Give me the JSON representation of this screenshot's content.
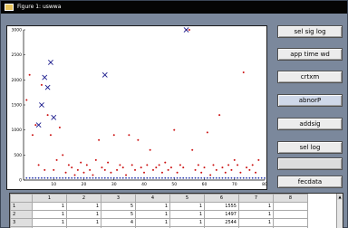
{
  "window": {
    "title": "Figure 1: uswwa"
  },
  "buttons": [
    {
      "label": "sel sig log",
      "state": "normal"
    },
    {
      "label": "app time wd",
      "state": "normal"
    },
    {
      "label": "crtxm",
      "state": "normal"
    },
    {
      "label": "abnorP",
      "state": "active"
    },
    {
      "label": "addsig",
      "state": "normal"
    },
    {
      "label": "sel log",
      "state": "normal"
    },
    {
      "label": "",
      "state": "blank"
    },
    {
      "label": "fecdata",
      "state": "normal"
    }
  ],
  "chart_data": {
    "type": "scatter",
    "xlim": [
      0,
      80
    ],
    "ylim": [
      0,
      3000
    ],
    "x_ticks": [
      "10",
      "20",
      "30",
      "40",
      "50",
      "60",
      "70",
      "80"
    ],
    "y_ticks": [
      "0",
      "500",
      "1000",
      "1500",
      "2000",
      "2500",
      "3000"
    ],
    "grid": false,
    "series": [
      {
        "marker": "red-dot",
        "color": "#cc1111",
        "points": [
          [
            1,
            1600
          ],
          [
            2,
            2100
          ],
          [
            3,
            900
          ],
          [
            4,
            1100
          ],
          [
            5,
            300
          ],
          [
            6,
            1900
          ],
          [
            7,
            200
          ],
          [
            8,
            1300
          ],
          [
            9,
            900
          ],
          [
            10,
            200
          ],
          [
            11,
            400
          ],
          [
            12,
            1050
          ],
          [
            13,
            500
          ],
          [
            14,
            150
          ],
          [
            15,
            300
          ],
          [
            16,
            250
          ],
          [
            17,
            100
          ],
          [
            18,
            200
          ],
          [
            19,
            350
          ],
          [
            20,
            150
          ],
          [
            21,
            300
          ],
          [
            22,
            200
          ],
          [
            23,
            100
          ],
          [
            24,
            400
          ],
          [
            25,
            800
          ],
          [
            26,
            250
          ],
          [
            27,
            200
          ],
          [
            28,
            350
          ],
          [
            29,
            150
          ],
          [
            30,
            900
          ],
          [
            31,
            200
          ],
          [
            32,
            300
          ],
          [
            33,
            250
          ],
          [
            34,
            100
          ],
          [
            35,
            900
          ],
          [
            36,
            300
          ],
          [
            37,
            200
          ],
          [
            38,
            800
          ],
          [
            39,
            250
          ],
          [
            40,
            150
          ],
          [
            41,
            300
          ],
          [
            42,
            600
          ],
          [
            43,
            200
          ],
          [
            44,
            250
          ],
          [
            45,
            300
          ],
          [
            46,
            150
          ],
          [
            47,
            350
          ],
          [
            48,
            200
          ],
          [
            49,
            250
          ],
          [
            50,
            1000
          ],
          [
            51,
            150
          ],
          [
            52,
            300
          ],
          [
            53,
            250
          ],
          [
            54,
            3750
          ],
          [
            55,
            3550
          ],
          [
            56,
            600
          ],
          [
            57,
            200
          ],
          [
            58,
            300
          ],
          [
            59,
            150
          ],
          [
            60,
            250
          ],
          [
            61,
            950
          ],
          [
            62,
            100
          ],
          [
            63,
            300
          ],
          [
            64,
            200
          ],
          [
            65,
            1300
          ],
          [
            66,
            250
          ],
          [
            67,
            150
          ],
          [
            68,
            300
          ],
          [
            69,
            200
          ],
          [
            70,
            400
          ],
          [
            71,
            300
          ],
          [
            72,
            150
          ],
          [
            73,
            2150
          ],
          [
            74,
            250
          ],
          [
            75,
            200
          ],
          [
            76,
            300
          ],
          [
            77,
            150
          ],
          [
            78,
            400
          ]
        ]
      },
      {
        "marker": "blue-x",
        "color": "#1a1a8c",
        "points": [
          [
            5,
            1100
          ],
          [
            6,
            1500
          ],
          [
            7,
            2050
          ],
          [
            8,
            1850
          ],
          [
            9,
            2350
          ],
          [
            10,
            1250
          ],
          [
            27,
            2100
          ],
          [
            54,
            3750
          ]
        ]
      },
      {
        "marker": "baseline-blue",
        "color": "#2233aa",
        "points": [
          [
            1,
            40
          ],
          [
            2,
            40
          ],
          [
            3,
            40
          ],
          [
            4,
            40
          ],
          [
            5,
            40
          ],
          [
            6,
            40
          ],
          [
            7,
            40
          ],
          [
            8,
            40
          ],
          [
            9,
            40
          ],
          [
            10,
            40
          ],
          [
            11,
            40
          ],
          [
            12,
            40
          ],
          [
            13,
            40
          ],
          [
            14,
            40
          ],
          [
            15,
            40
          ],
          [
            16,
            40
          ],
          [
            17,
            40
          ],
          [
            18,
            40
          ],
          [
            19,
            40
          ],
          [
            20,
            40
          ],
          [
            21,
            40
          ],
          [
            22,
            40
          ],
          [
            23,
            40
          ],
          [
            24,
            40
          ],
          [
            25,
            40
          ],
          [
            26,
            40
          ],
          [
            27,
            40
          ],
          [
            28,
            40
          ],
          [
            29,
            40
          ],
          [
            30,
            40
          ],
          [
            31,
            40
          ],
          [
            32,
            40
          ],
          [
            33,
            40
          ],
          [
            34,
            40
          ],
          [
            35,
            40
          ],
          [
            36,
            40
          ],
          [
            37,
            40
          ],
          [
            38,
            40
          ],
          [
            39,
            40
          ],
          [
            40,
            40
          ],
          [
            41,
            40
          ],
          [
            42,
            40
          ],
          [
            43,
            40
          ],
          [
            44,
            40
          ],
          [
            45,
            40
          ],
          [
            46,
            40
          ],
          [
            47,
            40
          ],
          [
            48,
            40
          ],
          [
            49,
            40
          ],
          [
            50,
            40
          ],
          [
            51,
            40
          ],
          [
            52,
            40
          ],
          [
            53,
            40
          ],
          [
            54,
            40
          ],
          [
            55,
            40
          ],
          [
            56,
            40
          ],
          [
            57,
            40
          ],
          [
            58,
            40
          ],
          [
            59,
            40
          ],
          [
            60,
            40
          ],
          [
            61,
            40
          ],
          [
            62,
            40
          ],
          [
            63,
            40
          ],
          [
            64,
            40
          ],
          [
            65,
            40
          ],
          [
            66,
            40
          ],
          [
            67,
            40
          ],
          [
            68,
            40
          ],
          [
            69,
            40
          ],
          [
            70,
            40
          ],
          [
            71,
            40
          ],
          [
            72,
            40
          ],
          [
            73,
            40
          ],
          [
            74,
            40
          ],
          [
            75,
            40
          ],
          [
            76,
            40
          ],
          [
            77,
            40
          ],
          [
            78,
            40
          ],
          [
            79,
            40
          ],
          [
            80,
            40
          ]
        ]
      }
    ]
  },
  "table": {
    "columns": [
      "",
      "1",
      "2",
      "3",
      "4",
      "5",
      "6",
      "7",
      "8"
    ],
    "rows": [
      [
        "1",
        "1",
        "1",
        "5",
        "1",
        "1",
        "1555",
        "1",
        ""
      ],
      [
        "2",
        "1",
        "1",
        "5",
        "1",
        "1",
        "1497",
        "1",
        ""
      ],
      [
        "3",
        "1",
        "1",
        "4",
        "1",
        "1",
        "2544",
        "1",
        ""
      ],
      [
        "4",
        "1",
        "1",
        "4",
        "1",
        "1",
        "1579",
        "1",
        ""
      ]
    ]
  }
}
